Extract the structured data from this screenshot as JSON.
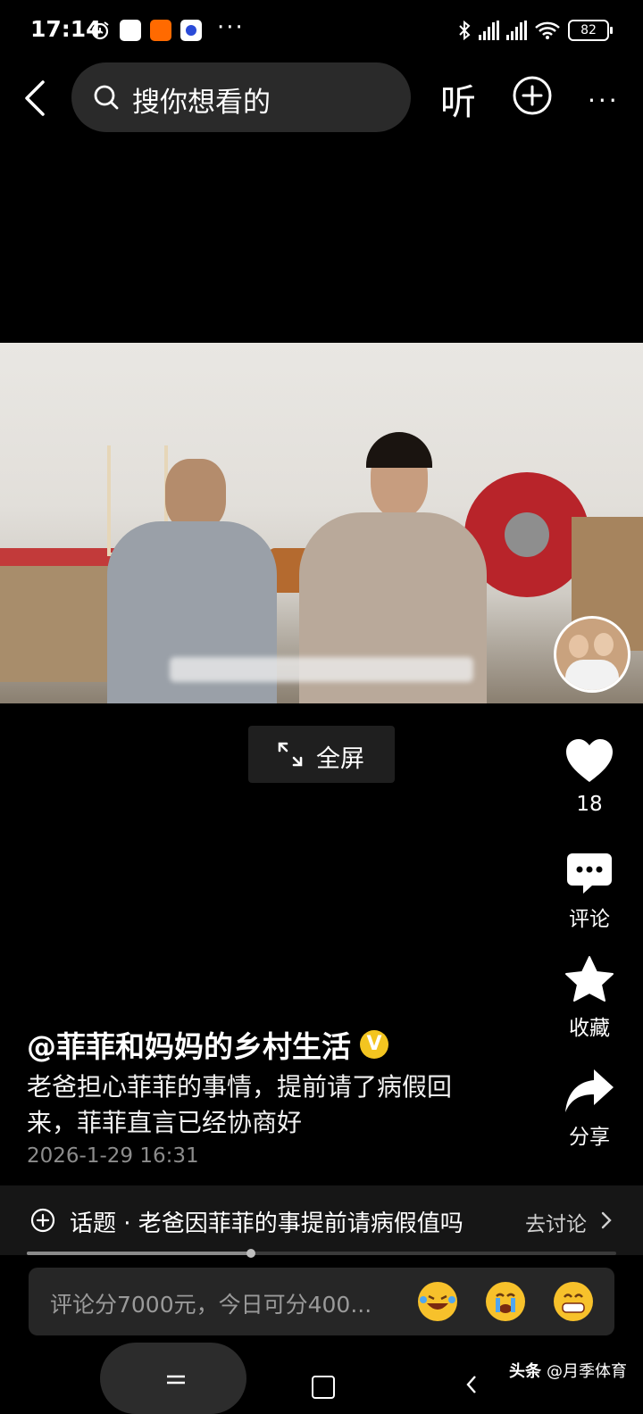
{
  "status_bar": {
    "time": "17:14",
    "more": "···",
    "battery": "82"
  },
  "nav": {
    "search_placeholder": "搜你想看的",
    "listen_label": "听"
  },
  "video": {
    "fullscreen_label": "全屏"
  },
  "actions": {
    "like_count": "18",
    "comment_label": "评论",
    "favorite_label": "收藏",
    "share_label": "分享"
  },
  "post": {
    "author": "@菲菲和妈妈的乡村生活",
    "verified_badge": "V",
    "caption": "老爸担心菲菲的事情，提前请了病假回来，菲菲直言已经协商好",
    "date": "2026-1-29 16:31"
  },
  "topic": {
    "text": "话题 · 老爸因菲菲的事提前请病假值吗",
    "discuss_label": "去讨论"
  },
  "playback": {
    "progress": 0.38
  },
  "comment_box": {
    "placeholder": "评论分7000元，今日可分400..."
  },
  "watermark": {
    "brand": "头条",
    "account": "@月季体育"
  },
  "colors": {
    "badge": "#f3c520",
    "background": "#000000",
    "panel": "#262626"
  }
}
